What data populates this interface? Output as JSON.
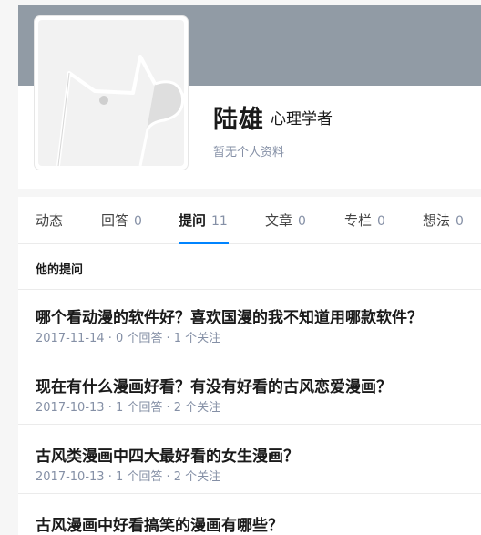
{
  "profile": {
    "name": "陆雄",
    "headline": "心理学者",
    "intro": "暂无个人资料"
  },
  "tabs": [
    {
      "label": "动态",
      "count": ""
    },
    {
      "label": "回答",
      "count": "0"
    },
    {
      "label": "提问",
      "count": "11"
    },
    {
      "label": "文章",
      "count": "0"
    },
    {
      "label": "专栏",
      "count": "0"
    },
    {
      "label": "想法",
      "count": "0"
    }
  ],
  "active_tab": "提问",
  "section_title": "他的提问",
  "questions": [
    {
      "title": "哪个看动漫的软件好？喜欢国漫的我不知道用哪款软件？",
      "date": "2017-11-14",
      "answers": "0 个回答",
      "follows": "1 个关注"
    },
    {
      "title": "现在有什么漫画好看？有没有好看的古风恋爱漫画？",
      "date": "2017-10-13",
      "answers": "1 个回答",
      "follows": "2 个关注"
    },
    {
      "title": "古风类漫画中四大最好看的女生漫画？",
      "date": "2017-10-13",
      "answers": "1 个回答",
      "follows": "2 个关注"
    },
    {
      "title": "古风漫画中好看搞笑的漫画有哪些？",
      "date": "",
      "answers": "",
      "follows": ""
    }
  ],
  "meta_separator": " · ",
  "icons": [
    "default-avatar-dog-icon"
  ],
  "colors": {
    "cover": "#919ba5",
    "accent": "#0084ff",
    "meta": "#8590a6"
  }
}
